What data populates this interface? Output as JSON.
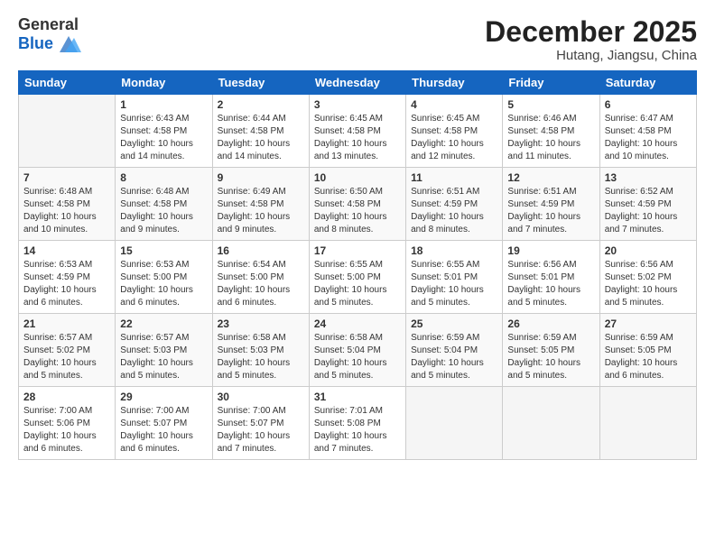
{
  "header": {
    "logo_general": "General",
    "logo_blue": "Blue",
    "title": "December 2025",
    "location": "Hutang, Jiangsu, China"
  },
  "days_of_week": [
    "Sunday",
    "Monday",
    "Tuesday",
    "Wednesday",
    "Thursday",
    "Friday",
    "Saturday"
  ],
  "weeks": [
    [
      {
        "day": "",
        "info": ""
      },
      {
        "day": "1",
        "info": "Sunrise: 6:43 AM\nSunset: 4:58 PM\nDaylight: 10 hours\nand 14 minutes."
      },
      {
        "day": "2",
        "info": "Sunrise: 6:44 AM\nSunset: 4:58 PM\nDaylight: 10 hours\nand 14 minutes."
      },
      {
        "day": "3",
        "info": "Sunrise: 6:45 AM\nSunset: 4:58 PM\nDaylight: 10 hours\nand 13 minutes."
      },
      {
        "day": "4",
        "info": "Sunrise: 6:45 AM\nSunset: 4:58 PM\nDaylight: 10 hours\nand 12 minutes."
      },
      {
        "day": "5",
        "info": "Sunrise: 6:46 AM\nSunset: 4:58 PM\nDaylight: 10 hours\nand 11 minutes."
      },
      {
        "day": "6",
        "info": "Sunrise: 6:47 AM\nSunset: 4:58 PM\nDaylight: 10 hours\nand 10 minutes."
      }
    ],
    [
      {
        "day": "7",
        "info": "Sunrise: 6:48 AM\nSunset: 4:58 PM\nDaylight: 10 hours\nand 10 minutes."
      },
      {
        "day": "8",
        "info": "Sunrise: 6:48 AM\nSunset: 4:58 PM\nDaylight: 10 hours\nand 9 minutes."
      },
      {
        "day": "9",
        "info": "Sunrise: 6:49 AM\nSunset: 4:58 PM\nDaylight: 10 hours\nand 9 minutes."
      },
      {
        "day": "10",
        "info": "Sunrise: 6:50 AM\nSunset: 4:58 PM\nDaylight: 10 hours\nand 8 minutes."
      },
      {
        "day": "11",
        "info": "Sunrise: 6:51 AM\nSunset: 4:59 PM\nDaylight: 10 hours\nand 8 minutes."
      },
      {
        "day": "12",
        "info": "Sunrise: 6:51 AM\nSunset: 4:59 PM\nDaylight: 10 hours\nand 7 minutes."
      },
      {
        "day": "13",
        "info": "Sunrise: 6:52 AM\nSunset: 4:59 PM\nDaylight: 10 hours\nand 7 minutes."
      }
    ],
    [
      {
        "day": "14",
        "info": "Sunrise: 6:53 AM\nSunset: 4:59 PM\nDaylight: 10 hours\nand 6 minutes."
      },
      {
        "day": "15",
        "info": "Sunrise: 6:53 AM\nSunset: 5:00 PM\nDaylight: 10 hours\nand 6 minutes."
      },
      {
        "day": "16",
        "info": "Sunrise: 6:54 AM\nSunset: 5:00 PM\nDaylight: 10 hours\nand 6 minutes."
      },
      {
        "day": "17",
        "info": "Sunrise: 6:55 AM\nSunset: 5:00 PM\nDaylight: 10 hours\nand 5 minutes."
      },
      {
        "day": "18",
        "info": "Sunrise: 6:55 AM\nSunset: 5:01 PM\nDaylight: 10 hours\nand 5 minutes."
      },
      {
        "day": "19",
        "info": "Sunrise: 6:56 AM\nSunset: 5:01 PM\nDaylight: 10 hours\nand 5 minutes."
      },
      {
        "day": "20",
        "info": "Sunrise: 6:56 AM\nSunset: 5:02 PM\nDaylight: 10 hours\nand 5 minutes."
      }
    ],
    [
      {
        "day": "21",
        "info": "Sunrise: 6:57 AM\nSunset: 5:02 PM\nDaylight: 10 hours\nand 5 minutes."
      },
      {
        "day": "22",
        "info": "Sunrise: 6:57 AM\nSunset: 5:03 PM\nDaylight: 10 hours\nand 5 minutes."
      },
      {
        "day": "23",
        "info": "Sunrise: 6:58 AM\nSunset: 5:03 PM\nDaylight: 10 hours\nand 5 minutes."
      },
      {
        "day": "24",
        "info": "Sunrise: 6:58 AM\nSunset: 5:04 PM\nDaylight: 10 hours\nand 5 minutes."
      },
      {
        "day": "25",
        "info": "Sunrise: 6:59 AM\nSunset: 5:04 PM\nDaylight: 10 hours\nand 5 minutes."
      },
      {
        "day": "26",
        "info": "Sunrise: 6:59 AM\nSunset: 5:05 PM\nDaylight: 10 hours\nand 5 minutes."
      },
      {
        "day": "27",
        "info": "Sunrise: 6:59 AM\nSunset: 5:05 PM\nDaylight: 10 hours\nand 6 minutes."
      }
    ],
    [
      {
        "day": "28",
        "info": "Sunrise: 7:00 AM\nSunset: 5:06 PM\nDaylight: 10 hours\nand 6 minutes."
      },
      {
        "day": "29",
        "info": "Sunrise: 7:00 AM\nSunset: 5:07 PM\nDaylight: 10 hours\nand 6 minutes."
      },
      {
        "day": "30",
        "info": "Sunrise: 7:00 AM\nSunset: 5:07 PM\nDaylight: 10 hours\nand 7 minutes."
      },
      {
        "day": "31",
        "info": "Sunrise: 7:01 AM\nSunset: 5:08 PM\nDaylight: 10 hours\nand 7 minutes."
      },
      {
        "day": "",
        "info": ""
      },
      {
        "day": "",
        "info": ""
      },
      {
        "day": "",
        "info": ""
      }
    ]
  ]
}
